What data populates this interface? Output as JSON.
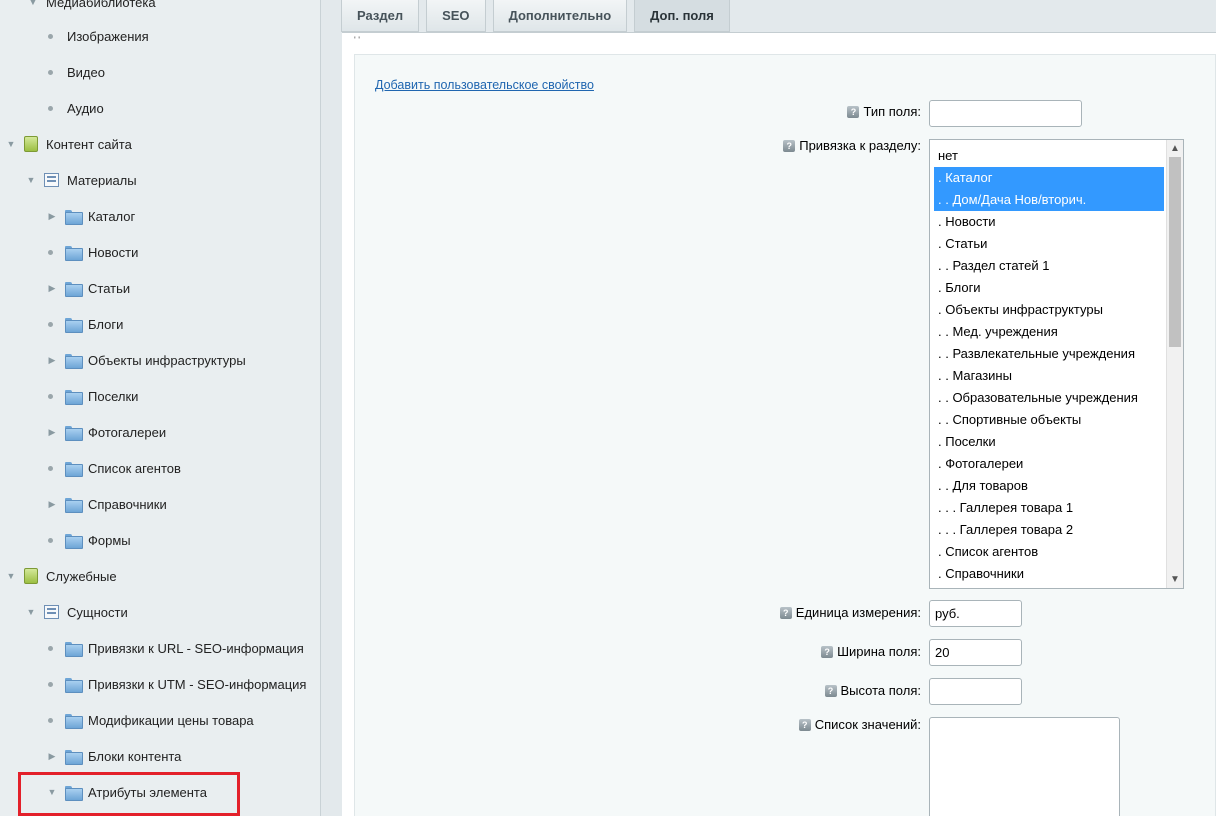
{
  "sidebar": {
    "top_partial": "Медиабиблиотека",
    "items": [
      {
        "label": "Изображения"
      },
      {
        "label": "Видео"
      },
      {
        "label": "Аудио"
      },
      {
        "label": "Контент сайта"
      },
      {
        "label": "Материалы"
      },
      {
        "label": "Каталог"
      },
      {
        "label": "Новости"
      },
      {
        "label": "Статьи"
      },
      {
        "label": "Блоги"
      },
      {
        "label": "Объекты инфраструктуры"
      },
      {
        "label": "Поселки"
      },
      {
        "label": "Фотогалереи"
      },
      {
        "label": "Список агентов"
      },
      {
        "label": "Справочники"
      },
      {
        "label": "Формы"
      },
      {
        "label": "Служебные"
      },
      {
        "label": "Сущности"
      },
      {
        "label": "Привязки к URL - SEO-информация"
      },
      {
        "label": "Привязки к UTM - SEO-информация"
      },
      {
        "label": "Модификации цены товара"
      },
      {
        "label": "Блоки контента"
      },
      {
        "label": "Атрибуты элемента"
      }
    ]
  },
  "tabs": [
    {
      "label": "Раздел"
    },
    {
      "label": "SEO"
    },
    {
      "label": "Дополнительно"
    },
    {
      "label": "Доп. поля"
    }
  ],
  "form": {
    "ticks": "' '",
    "add_link": "Добавить пользовательское свойство",
    "field_type_label": "Тип поля:",
    "field_type_value": "",
    "section_binding_label": "Привязка к разделу:",
    "section_options": [
      {
        "label": "нет",
        "selected": false
      },
      {
        "label": ". Каталог",
        "selected": true
      },
      {
        "label": ". . Дом/Дача Нов/вторич.",
        "selected": true
      },
      {
        "label": ". Новости",
        "selected": false
      },
      {
        "label": ". Статьи",
        "selected": false
      },
      {
        "label": ". . Раздел статей 1",
        "selected": false
      },
      {
        "label": ". Блоги",
        "selected": false
      },
      {
        "label": ". Объекты инфраструктуры",
        "selected": false
      },
      {
        "label": ". . Мед. учреждения",
        "selected": false
      },
      {
        "label": ". . Развлекательные учреждения",
        "selected": false
      },
      {
        "label": ". . Магазины",
        "selected": false
      },
      {
        "label": ". . Образовательные учреждения",
        "selected": false
      },
      {
        "label": ". . Спортивные объекты",
        "selected": false
      },
      {
        "label": ". Поселки",
        "selected": false
      },
      {
        "label": ". Фотогалереи",
        "selected": false
      },
      {
        "label": ". . Для товаров",
        "selected": false
      },
      {
        "label": ". . . Галлерея товара 1",
        "selected": false
      },
      {
        "label": ". . . Галлерея товара 2",
        "selected": false
      },
      {
        "label": ". Список агентов",
        "selected": false
      },
      {
        "label": ". Справочники",
        "selected": false
      }
    ],
    "unit_label": "Единица измерения:",
    "unit_value": "руб.",
    "width_label": "Ширина поля:",
    "width_value": "20",
    "height_label": "Высота поля:",
    "height_value": "",
    "values_list_label": "Список значений:",
    "values_list_value": ""
  },
  "colors": {
    "selection": "#3399ff",
    "highlight_box": "#e3202a",
    "link": "#2066b0"
  }
}
